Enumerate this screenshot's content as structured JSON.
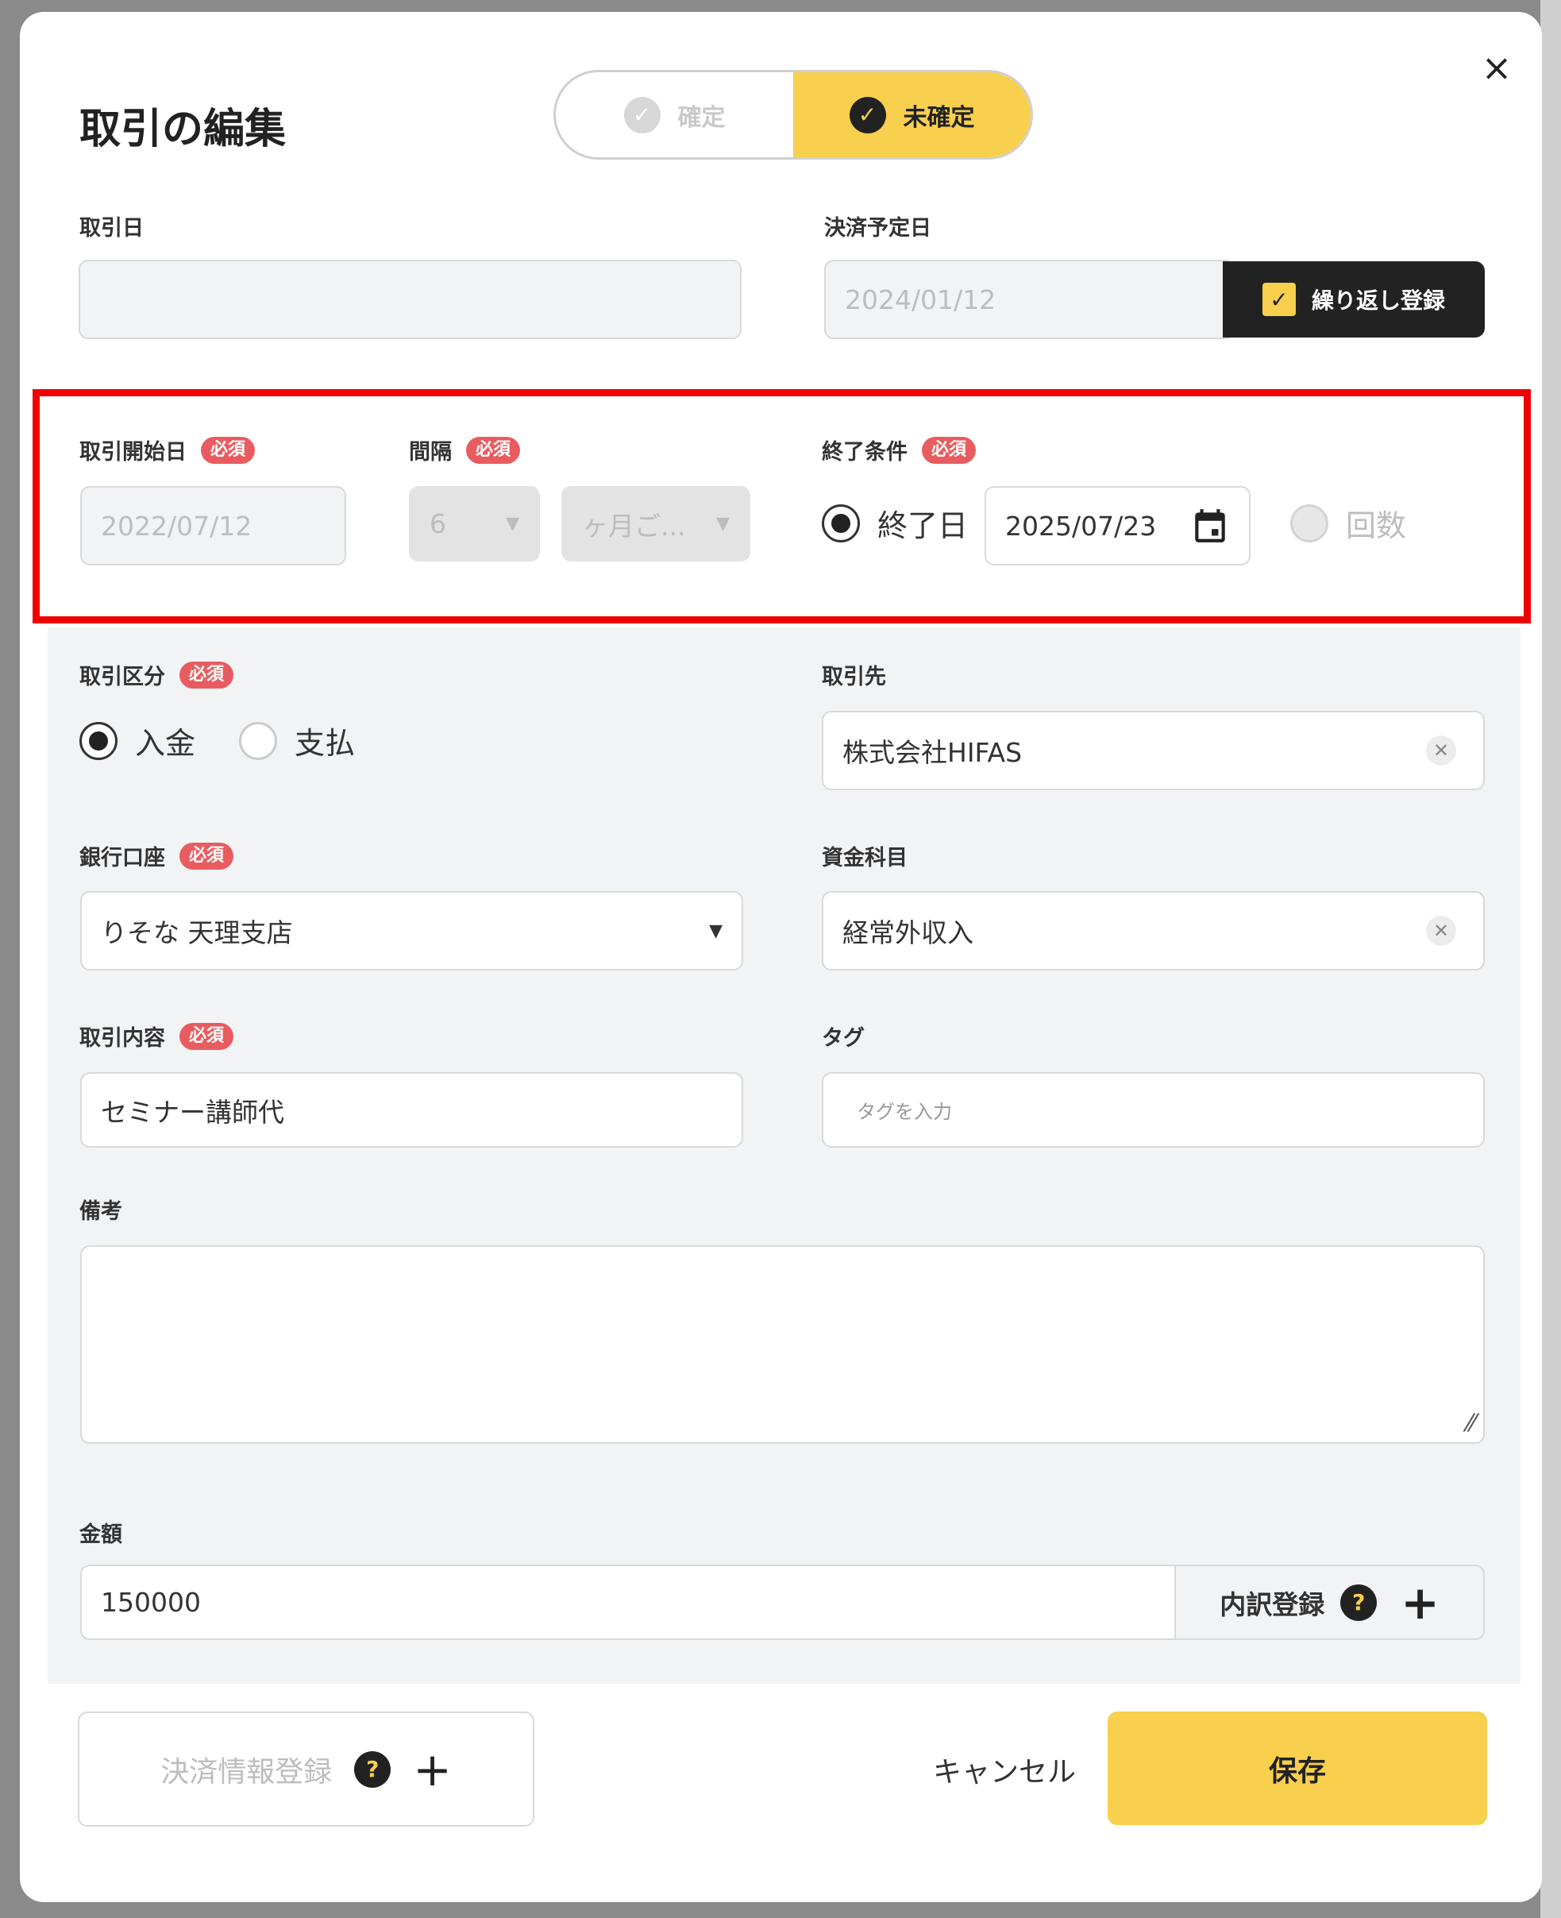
{
  "dialog": {
    "title": "取引の編集",
    "close_symbol": "×",
    "status_toggle": {
      "confirmed_label": "確定",
      "unconfirmed_label": "未確定",
      "selected": "未確定"
    }
  },
  "fields": {
    "transaction_date": {
      "label": "取引日",
      "value": ""
    },
    "settlement_date": {
      "label": "決済予定日",
      "value": "2024/01/12",
      "repeat_label": "繰り返し登録",
      "repeat_checked": true
    },
    "start_date": {
      "label": "取引開始日",
      "required": "必須",
      "value": "2022/07/12"
    },
    "interval": {
      "label": "間隔",
      "required": "必須",
      "number": "6",
      "unit": "ヶ月ご..."
    },
    "end_condition": {
      "label": "終了条件",
      "required": "必須",
      "option_end_date": "終了日",
      "end_date": "2025/07/23",
      "option_count": "回数",
      "selected": "終了日"
    },
    "transaction_type": {
      "label": "取引区分",
      "required": "必須",
      "option_income": "入金",
      "option_payment": "支払",
      "selected": "入金"
    },
    "partner": {
      "label": "取引先",
      "value": "株式会社HIFAS"
    },
    "bank_account": {
      "label": "銀行口座",
      "required": "必須",
      "value": "りそな 天理支店"
    },
    "fund_item": {
      "label": "資金科目",
      "value": "経常外収入"
    },
    "content": {
      "label": "取引内容",
      "required": "必須",
      "value": "セミナー講師代"
    },
    "tags": {
      "label": "タグ",
      "placeholder": "タグを入力"
    },
    "memo": {
      "label": "備考",
      "value": ""
    },
    "amount": {
      "label": "金額",
      "value": "150000",
      "breakdown_label": "内訳登録"
    }
  },
  "footer": {
    "payment_info_label": "決済情報登録",
    "cancel_label": "キャンセル",
    "save_label": "保存"
  },
  "colors": {
    "accent": "#f9cf4e",
    "required_badge": "#e85c60",
    "highlight_border": "#f00000",
    "dark": "#222222"
  }
}
